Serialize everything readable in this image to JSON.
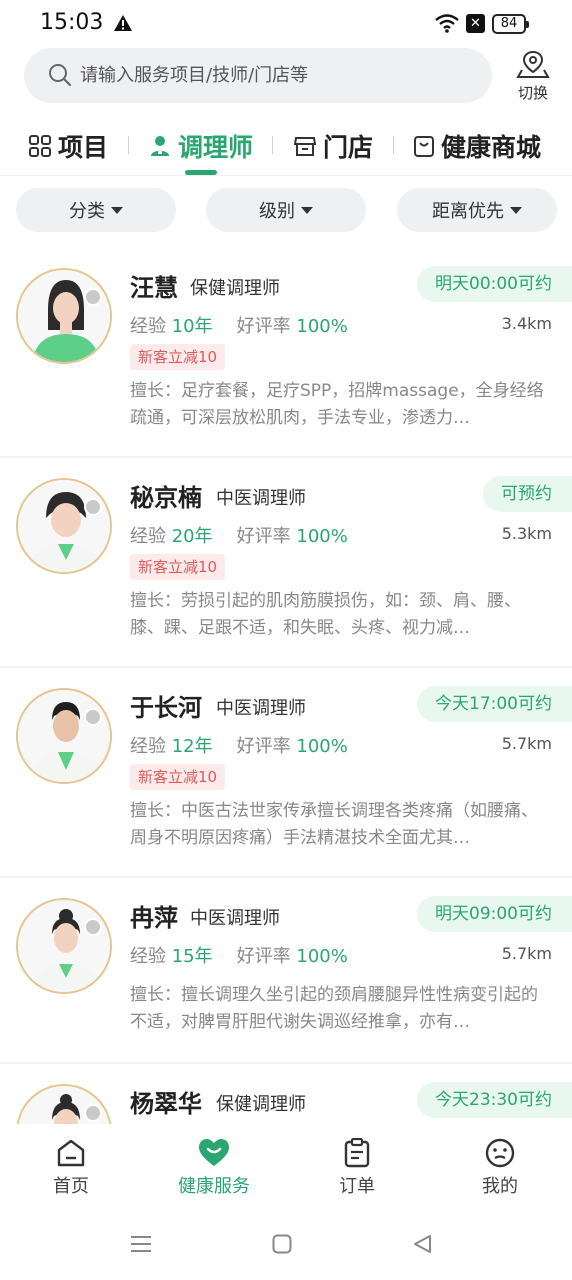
{
  "status_bar": {
    "time": "15:03",
    "battery": "84"
  },
  "search": {
    "placeholder": "请输入服务项目/技师/门店等",
    "switch_label": "切换"
  },
  "tabs": [
    {
      "label": "项目",
      "icon": "grid-icon",
      "active": false
    },
    {
      "label": "调理师",
      "icon": "therapist-icon",
      "active": true
    },
    {
      "label": "门店",
      "icon": "store-icon",
      "active": false
    },
    {
      "label": "健康商城",
      "icon": "shopping-bag-icon",
      "active": false
    }
  ],
  "filters": [
    {
      "label": "分类"
    },
    {
      "label": "级别"
    },
    {
      "label": "距离优先"
    }
  ],
  "labels": {
    "experience": "经验",
    "rating": "好评率"
  },
  "therapists": [
    {
      "name": "汪慧",
      "title": "保健调理师",
      "availability": "明天00:00可约",
      "experience": "10年",
      "rating": "100%",
      "distance": "3.4km",
      "promo": "新客立减10",
      "description": "擅长：足疗套餐，足疗SPP，招牌massage，全身经络疏通，可深层放松肌肉，手法专业，渗透力…"
    },
    {
      "name": "秘京楠",
      "title": "中医调理师",
      "availability": "可预约",
      "experience": "20年",
      "rating": "100%",
      "distance": "5.3km",
      "promo": "新客立减10",
      "description": "擅长：劳损引起的肌肉筋膜损伤，如：颈、肩、腰、膝、踝、足跟不适，和失眠、头疼、视力减…"
    },
    {
      "name": "于长河",
      "title": "中医调理师",
      "availability": "今天17:00可约",
      "experience": "12年",
      "rating": "100%",
      "distance": "5.7km",
      "promo": "新客立减10",
      "description": "擅长：中医古法世家传承擅长调理各类疼痛（如腰痛、周身不明原因疼痛）手法精湛技术全面尤其…"
    },
    {
      "name": "冉萍",
      "title": "中医调理师",
      "availability": "明天09:00可约",
      "experience": "15年",
      "rating": "100%",
      "distance": "5.7km",
      "promo": "",
      "description": "擅长：擅长调理久坐引起的颈肩腰腿异性性病变引起的不适，对脾胃肝胆代谢失调巡经推拿，亦有…"
    },
    {
      "name": "杨翠华",
      "title": "保健调理师",
      "availability": "今天23:30可约",
      "experience": "",
      "rating": "",
      "distance": "",
      "promo": "",
      "description": ""
    }
  ],
  "bottom_nav": [
    {
      "label": "首页",
      "icon": "home-icon",
      "active": false
    },
    {
      "label": "健康服务",
      "icon": "heart-icon",
      "active": true
    },
    {
      "label": "订单",
      "icon": "clipboard-icon",
      "active": false
    },
    {
      "label": "我的",
      "icon": "smiley-icon",
      "active": false
    }
  ],
  "colors": {
    "accent": "#2aa771",
    "promo": "#e05a5a",
    "avatar_border": "#e3c68f"
  }
}
